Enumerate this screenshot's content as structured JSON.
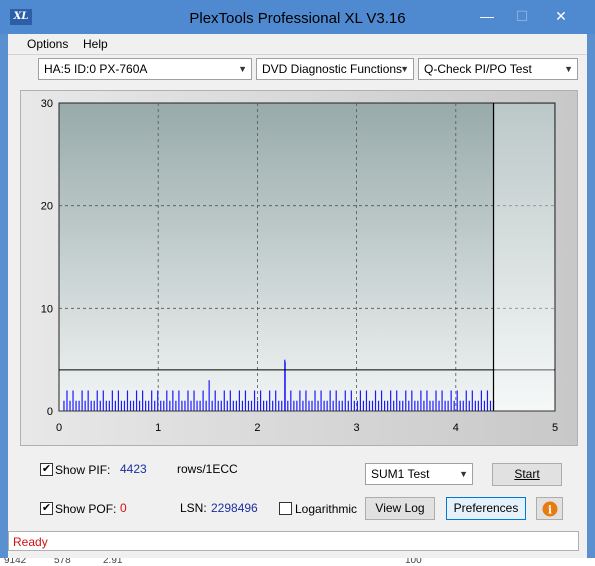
{
  "window": {
    "title": "PlexTools Professional XL V3.16",
    "logo_text": "XL",
    "icons": [
      "minimize-icon",
      "maximize-icon",
      "close-icon"
    ]
  },
  "menu": {
    "options": "Options",
    "help": "Help"
  },
  "toolbar": {
    "drive": "HA:5 ID:0  PX-760A",
    "function": "DVD Diagnostic Functions",
    "test": "Q-Check PI/PO Test"
  },
  "chart_data": {
    "type": "bar",
    "x_ticks": [
      "0",
      "1",
      "2",
      "3",
      "4",
      "5"
    ],
    "y_ticks": [
      "0",
      "10",
      "20",
      "30"
    ],
    "xlim": [
      0,
      5
    ],
    "ylim": [
      0,
      30
    ],
    "grid": true,
    "threshold": 4,
    "end_marker_x": 4.38,
    "series_color": "#1a1aff",
    "peak": {
      "x": 2.28,
      "y": 4.8
    },
    "pif_values": [
      1,
      2,
      1,
      2,
      1,
      1,
      2,
      1,
      2,
      1,
      1,
      2,
      1,
      2,
      1,
      1,
      2,
      1,
      2,
      1,
      1,
      2,
      1,
      1,
      2,
      1,
      2,
      1,
      1,
      2,
      1,
      2,
      1,
      1,
      2,
      1,
      2,
      1,
      2,
      1,
      1,
      2,
      1,
      2,
      1,
      1,
      2,
      1,
      3,
      1,
      2,
      1,
      1,
      2,
      1,
      2,
      1,
      1,
      2,
      1,
      2,
      1,
      1,
      2,
      1,
      2,
      1,
      1,
      2,
      1,
      2,
      1,
      1,
      5,
      1,
      2,
      1,
      1,
      2,
      1,
      2,
      1,
      1,
      2,
      1,
      2,
      1,
      1,
      2,
      1,
      2,
      1,
      1,
      2,
      1,
      2,
      1,
      1,
      2,
      1,
      2,
      1,
      1,
      2,
      1,
      2,
      1,
      1,
      2,
      1,
      2,
      1,
      1,
      2,
      1,
      2,
      1,
      1,
      2,
      1,
      2,
      1,
      1,
      2,
      1,
      2,
      1,
      1,
      2,
      1,
      2,
      1,
      1,
      2,
      1,
      2,
      1,
      1,
      2,
      1,
      2,
      1,
      1
    ]
  },
  "controls": {
    "show_pif_label": "Show PIF:",
    "pif_value": "4423",
    "rows_label": "rows/1ECC",
    "test_select": "SUM1 Test",
    "start_label": "Start",
    "show_pof_label": "Show POF:",
    "pof_value": "0",
    "lsn_label": "LSN:",
    "lsn_value": "2298496",
    "log_label": "Logarithmic",
    "view_log_label": "View Log",
    "preferences_label": "Preferences"
  },
  "status": {
    "text": "Ready"
  },
  "background": {
    "fragments": [
      "9142",
      "578",
      "2.91",
      "100"
    ]
  }
}
